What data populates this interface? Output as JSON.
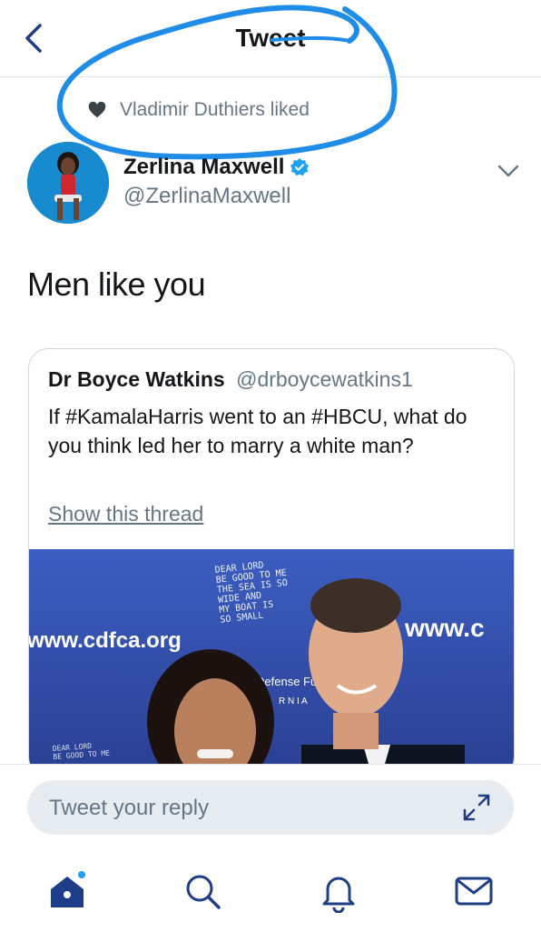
{
  "header": {
    "title": "Tweet",
    "back_icon": "chevron-left-icon"
  },
  "social_context": {
    "icon": "heart-icon",
    "text": "Vladimir Duthiers liked"
  },
  "author": {
    "name": "Zerlina Maxwell",
    "handle": "@ZerlinaMaxwell",
    "verified_icon": "verified-badge-icon"
  },
  "tweet": {
    "text": "Men like you"
  },
  "quoted_tweet": {
    "author_name": "Dr Boyce Watkins",
    "author_handle": "@drboycewatkins1",
    "text": "If #KamalaHarris went to an #HBCU, what do you think led her to marry a white man?",
    "thread_link": "Show this thread",
    "image_text": {
      "left_url": "www.cdfca.org",
      "right_url": "www.c",
      "poster_text": "DEAR LORD BE GOOD TO ME THE SEA IS SO WIDE AND MY BOAT IS SO SMALL",
      "defense_fund": "Defense Fund",
      "rnia": "R N I A",
      "small_poster_text": "DEAR LORD BE GOOD TO ME THE SEA IS SO"
    }
  },
  "reply": {
    "placeholder": "Tweet your reply",
    "expand_icon": "expand-icon"
  },
  "tabbar": {
    "tabs": [
      "home-icon",
      "search-icon",
      "notifications-icon",
      "messages-icon"
    ]
  },
  "colors": {
    "accent": "#1da1f2",
    "verified": "#1da1f2",
    "gray": "#657786",
    "scribble": "#1f8de8",
    "nav": "#1d3d86"
  }
}
